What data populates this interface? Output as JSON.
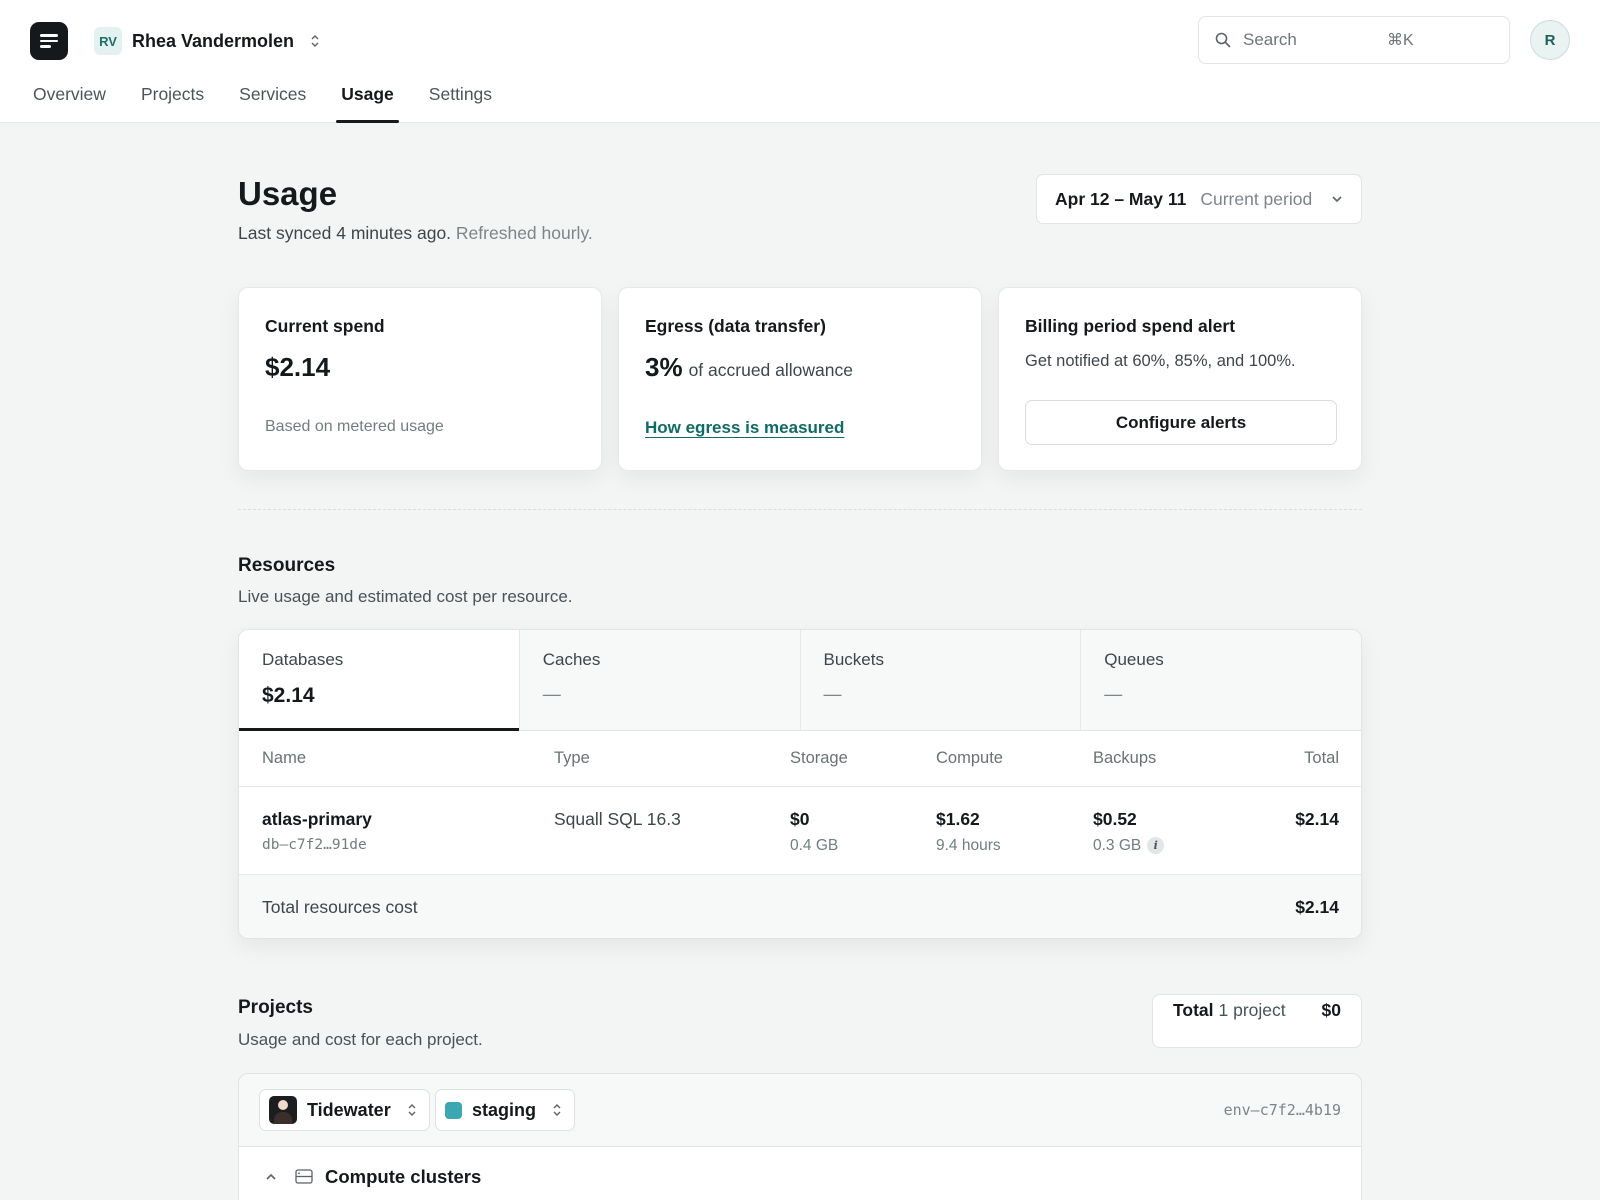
{
  "header": {
    "team_initials": "RV",
    "team_name": "Rhea Vandermolen",
    "search_placeholder": "Search",
    "search_shortcut": "⌘K",
    "avatar_initial": "R",
    "nav": [
      "Overview",
      "Projects",
      "Services",
      "Usage",
      "Settings"
    ],
    "nav_active": "Usage"
  },
  "page": {
    "title": "Usage",
    "sync_text": "Last synced 4 minutes ago.",
    "refresh_text": "Refreshed hourly.",
    "period_range": "Apr 12 – May 11",
    "period_label": "Current period"
  },
  "cards": {
    "spend": {
      "title": "Current spend",
      "value": "$2.14",
      "foot": "Based on metered usage"
    },
    "egress": {
      "title": "Egress (data transfer)",
      "percent": "3%",
      "suffix": "of accrued allowance",
      "link": "How egress is measured"
    },
    "alert": {
      "title": "Billing period spend alert",
      "desc": "Get notified at 60%, 85%, and 100%.",
      "button": "Configure alerts"
    }
  },
  "resources": {
    "title": "Resources",
    "subtitle": "Live usage and estimated cost per resource.",
    "tabs": [
      {
        "label": "Databases",
        "value": "$2.14"
      },
      {
        "label": "Caches",
        "value": "—"
      },
      {
        "label": "Buckets",
        "value": "—"
      },
      {
        "label": "Queues",
        "value": "—"
      }
    ],
    "columns": [
      "Name",
      "Type",
      "Storage",
      "Compute",
      "Backups",
      "Total"
    ],
    "rows": [
      {
        "name": "atlas-primary",
        "id": "db—c7f2…91de",
        "type": "Squall SQL 16.3",
        "storage": "$0",
        "storage_sub": "0.4 GB",
        "compute": "$1.62",
        "compute_sub": "9.4 hours",
        "backups": "$0.52",
        "backups_sub": "0.3 GB",
        "total": "$2.14"
      }
    ],
    "footer_label": "Total resources cost",
    "footer_value": "$2.14"
  },
  "projects": {
    "title": "Projects",
    "subtitle": "Usage and cost for each project.",
    "total_label": "Total",
    "total_count": "1 project",
    "total_amount": "$0",
    "project_name": "Tidewater",
    "env_name": "staging",
    "env_id": "env—c7f2…4b19",
    "section_label": "Compute clusters"
  },
  "colors": {
    "accent_link": "#0f6b66",
    "env_swatch": "#3aa7b3",
    "ink": "#16191b"
  }
}
